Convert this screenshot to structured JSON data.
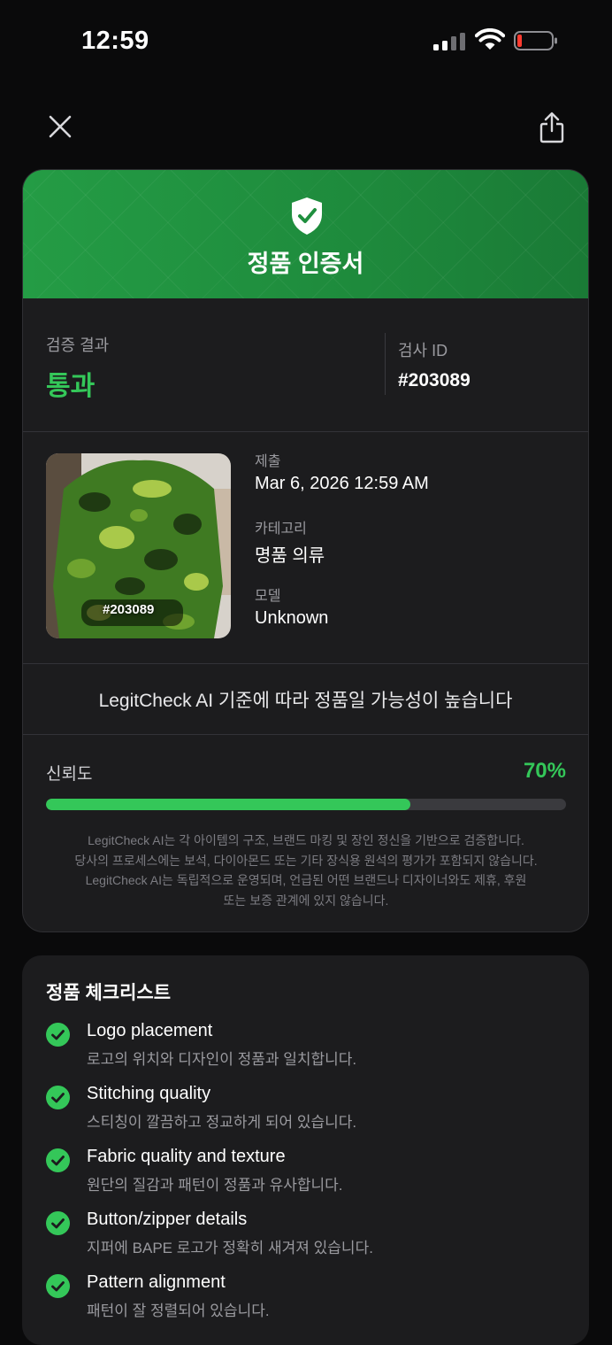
{
  "status": {
    "time": "12:59"
  },
  "header": {
    "close_icon": "close-icon",
    "share_icon": "share-icon"
  },
  "certificate": {
    "title": "정품 인증서",
    "result_label": "검증 결과",
    "result_value": "통과",
    "id_label": "검사 ID",
    "id_value": "#203089",
    "image_tag": "#203089",
    "submitted_label": "제출",
    "submitted_value": "Mar 6, 2026 12:59 AM",
    "category_label": "카테고리",
    "category_value": "명품 의류",
    "model_label": "모델",
    "model_value": "Unknown",
    "message": "LegitCheck AI 기준에 따라 정품일 가능성이 높습니다",
    "confidence_label": "신뢰도",
    "confidence_value": "70%",
    "confidence_fraction": 0.7,
    "disclaimer": [
      "LegitCheck AI는 각 아이템의 구조, 브랜드 마킹 및 장인 정신을 기반으로 검증합니다.",
      "당사의 프로세스에는 보석, 다이아몬드 또는 기타 장식용 원석의 평가가 포함되지 않습니다.",
      "LegitCheck AI는 독립적으로 운영되며, 언급된 어떤 브랜드나 디자이너와도 제휴, 후원",
      "또는 보증 관계에 있지 않습니다."
    ]
  },
  "checklist": {
    "title": "정품 체크리스트",
    "items": [
      {
        "name": "Logo placement",
        "desc": "로고의 위치와 디자인이 정품과 일치합니다."
      },
      {
        "name": "Stitching quality",
        "desc": "스티칭이 깔끔하고 정교하게 되어 있습니다."
      },
      {
        "name": "Fabric quality and texture",
        "desc": "원단의 질감과 패턴이 정품과 유사합니다."
      },
      {
        "name": "Button/zipper details",
        "desc": "지퍼에 BAPE 로고가 정확히 새겨져 있습니다."
      },
      {
        "name": "Pattern alignment",
        "desc": "패턴이 잘 정렬되어 있습니다."
      }
    ]
  },
  "colors": {
    "accent": "#34c759",
    "header_green": "#1f8f3e",
    "card": "#1c1c1e",
    "background": "#0a0a0b"
  }
}
